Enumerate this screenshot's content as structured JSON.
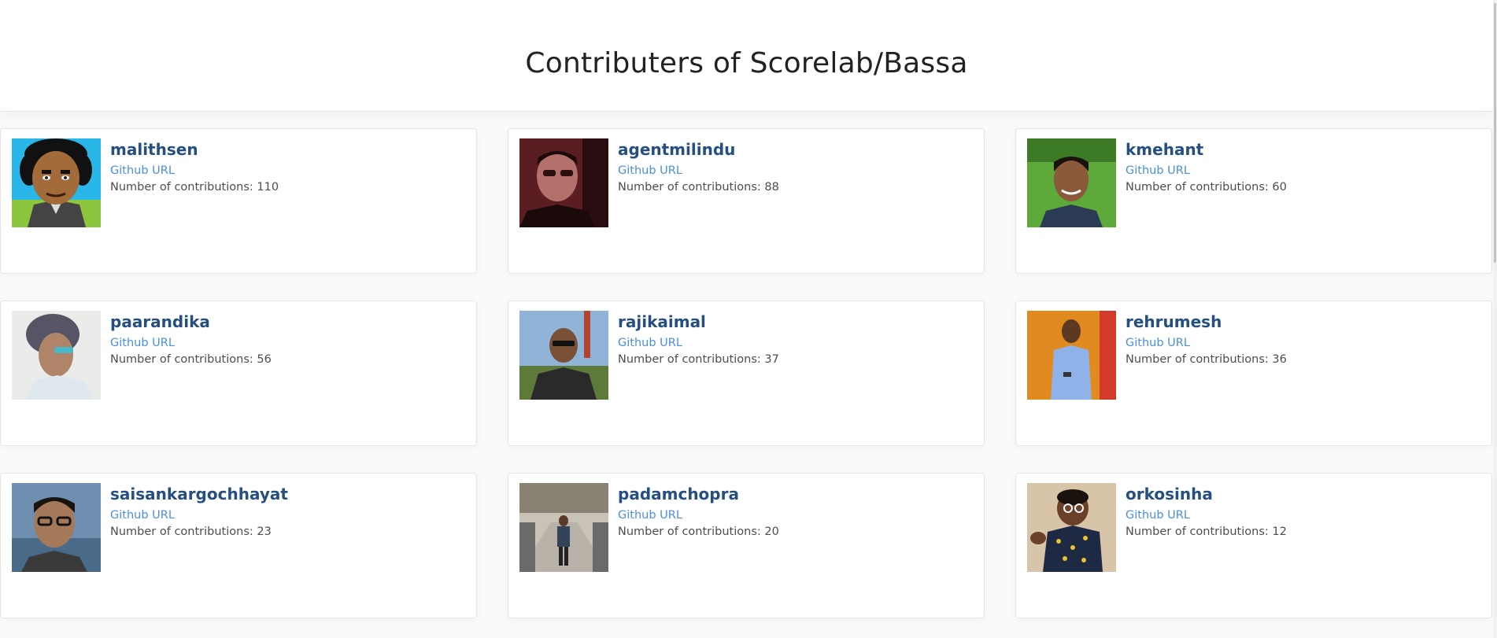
{
  "page": {
    "title": "Contributers of Scorelab/Bassa"
  },
  "link_label": "Github URL",
  "contributors": [
    {
      "username": "malithsen",
      "contributions": "Number of contributions: 110",
      "avatar": "cartoon-avatar"
    },
    {
      "username": "agentmilindu",
      "contributions": "Number of contributions: 88",
      "avatar": "photo-avatar"
    },
    {
      "username": "kmehant",
      "contributions": "Number of contributions: 60",
      "avatar": "photo-avatar"
    },
    {
      "username": "paarandika",
      "contributions": "Number of contributions: 56",
      "avatar": "photo-avatar"
    },
    {
      "username": "rajikaimal",
      "contributions": "Number of contributions: 37",
      "avatar": "photo-avatar"
    },
    {
      "username": "rehrumesh",
      "contributions": "Number of contributions: 36",
      "avatar": "photo-avatar"
    },
    {
      "username": "saisankargochhayat",
      "contributions": "Number of contributions: 23",
      "avatar": "photo-avatar"
    },
    {
      "username": "padamchopra",
      "contributions": "Number of contributions: 20",
      "avatar": "photo-avatar"
    },
    {
      "username": "orkosinha",
      "contributions": "Number of contributions: 12",
      "avatar": "illustration-avatar"
    }
  ],
  "colors": {
    "username": "#244f80",
    "link": "#4a8fe0",
    "text": "#4d4d4d",
    "background": "#fafafa"
  }
}
